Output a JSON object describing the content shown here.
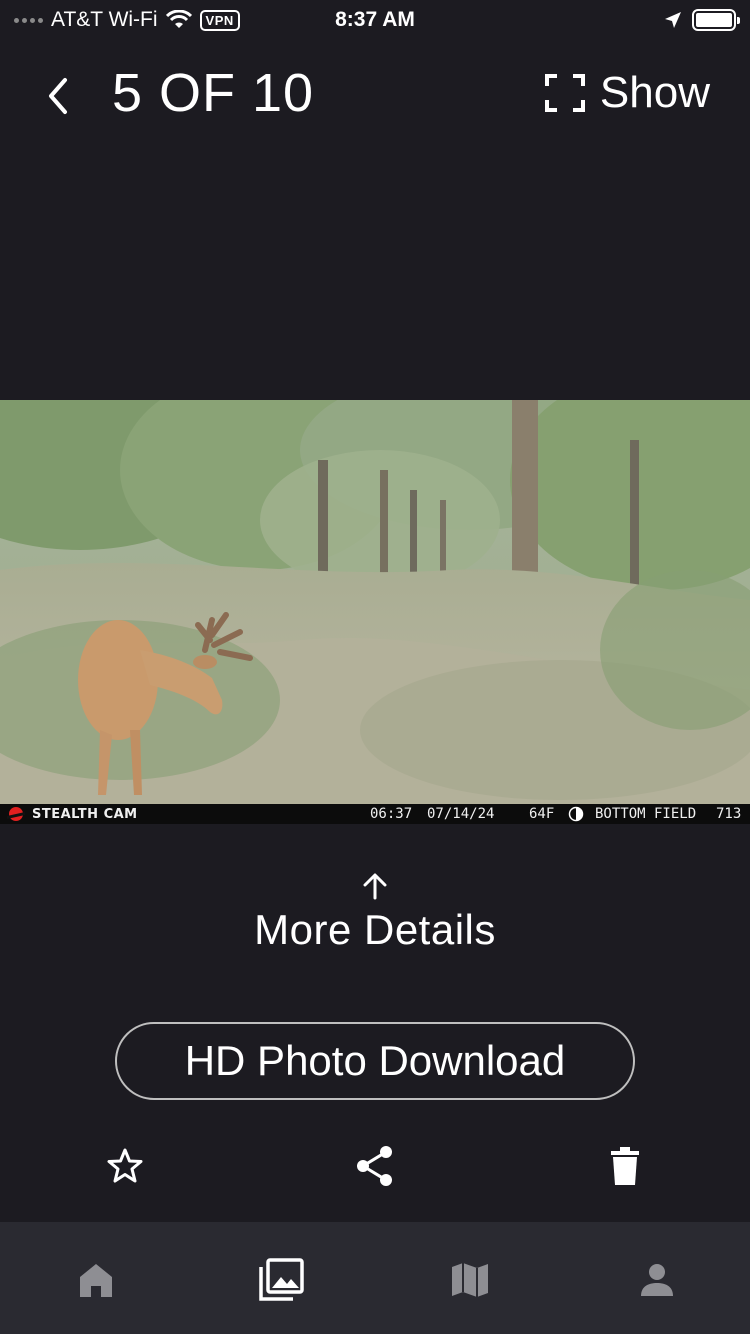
{
  "status_bar": {
    "carrier": "AT&T Wi-Fi",
    "vpn": "VPN",
    "time": "8:37 AM",
    "icons": [
      "signal-dots-icon",
      "wifi-icon",
      "location-arrow-icon",
      "battery-icon"
    ]
  },
  "header": {
    "title": "5 OF 10",
    "show_label": "Show",
    "icons": [
      "chevron-left-icon",
      "fullscreen-icon"
    ]
  },
  "photo": {
    "description_icon": "trail-camera-photo",
    "brand": "STEALTH CAM",
    "time": "06:37",
    "date": "07/14/24",
    "temperature": "64F",
    "location": "BOTTOM FIELD",
    "frame_number": "713"
  },
  "details": {
    "more_details_label": "More Details",
    "hd_download_label": "HD Photo Download"
  },
  "actions": {
    "icons": [
      "star-icon",
      "share-icon",
      "trash-icon"
    ]
  },
  "bottom_nav": {
    "items": [
      {
        "icon": "home-icon",
        "active": false
      },
      {
        "icon": "gallery-icon",
        "active": true
      },
      {
        "icon": "map-icon",
        "active": false
      },
      {
        "icon": "profile-icon",
        "active": false
      }
    ]
  },
  "colors": {
    "background": "#1c1b21",
    "nav_background": "#2a2a31",
    "text": "#ffffff",
    "nav_inactive": "#8e8e93"
  }
}
